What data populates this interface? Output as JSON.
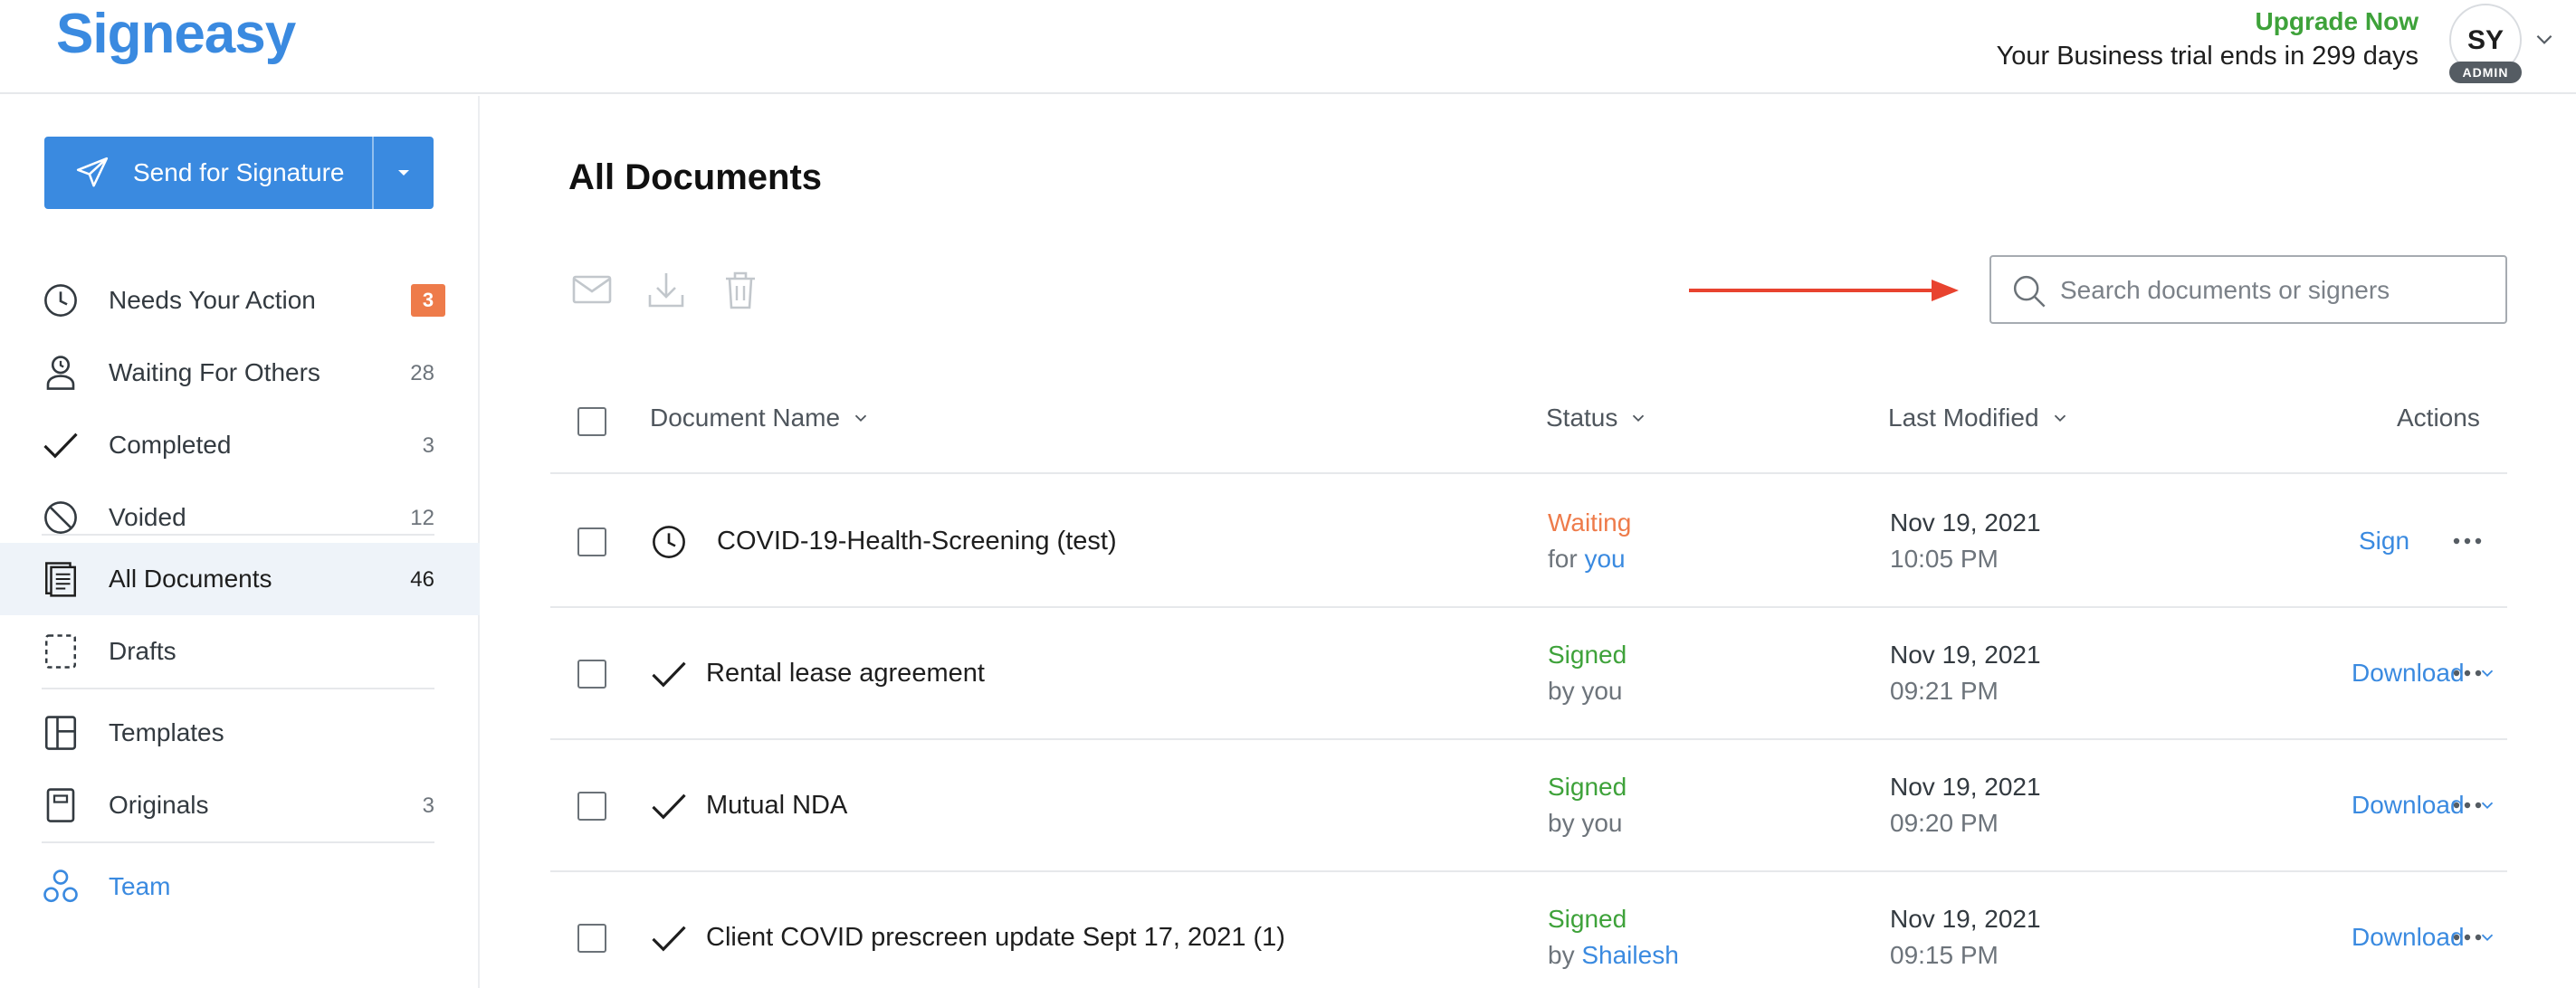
{
  "header": {
    "logo": "Signeasy",
    "upgrade": "Upgrade Now",
    "trial": "Your Business trial ends in 299 days",
    "avatar_initials": "SY",
    "avatar_role": "ADMIN"
  },
  "sidebar": {
    "send_label": "Send for Signature",
    "items": [
      {
        "label": "Needs Your Action",
        "count": "3",
        "icon": "clock-icon"
      },
      {
        "label": "Waiting For Others",
        "count": "28",
        "icon": "user-clock-icon"
      },
      {
        "label": "Completed",
        "count": "3",
        "icon": "check-icon"
      },
      {
        "label": "Voided",
        "count": "12",
        "icon": "ban-icon"
      },
      {
        "label": "All Documents",
        "count": "46",
        "icon": "documents-icon"
      },
      {
        "label": "Drafts",
        "count": "",
        "icon": "draft-icon"
      },
      {
        "label": "Templates",
        "count": "",
        "icon": "template-icon"
      },
      {
        "label": "Originals",
        "count": "3",
        "icon": "original-icon"
      },
      {
        "label": "Team",
        "count": "",
        "icon": "team-icon"
      }
    ]
  },
  "main": {
    "title": "All Documents",
    "search_placeholder": "Search documents or signers",
    "columns": {
      "name": "Document Name",
      "status": "Status",
      "modified": "Last Modified",
      "actions": "Actions"
    },
    "rows": [
      {
        "name": "COVID-19-Health-Screening (test)",
        "icon": "clock-icon",
        "status": "Waiting",
        "status_prefix": "for",
        "status_who": "you",
        "date": "Nov 19, 2021",
        "time": "10:05 PM",
        "action": "Sign"
      },
      {
        "name": "Rental lease agreement",
        "icon": "check-icon",
        "status": "Signed",
        "status_prefix": "by you",
        "status_who": "",
        "date": "Nov 19, 2021",
        "time": "09:21 PM",
        "action": "Download"
      },
      {
        "name": "Mutual NDA",
        "icon": "check-icon",
        "status": "Signed",
        "status_prefix": "by you",
        "status_who": "",
        "date": "Nov 19, 2021",
        "time": "09:20 PM",
        "action": "Download"
      },
      {
        "name": "Client COVID prescreen update Sept 17, 2021 (1)",
        "icon": "check-icon",
        "status": "Signed",
        "status_prefix": "by",
        "status_who": "Shailesh",
        "date": "Nov 19, 2021",
        "time": "09:15 PM",
        "action": "Download"
      }
    ]
  },
  "colors": {
    "accent": "#3a8ae0",
    "waiting": "#ee7b4a",
    "signed": "#3ea23a",
    "annotation_arrow": "#e8432f"
  }
}
